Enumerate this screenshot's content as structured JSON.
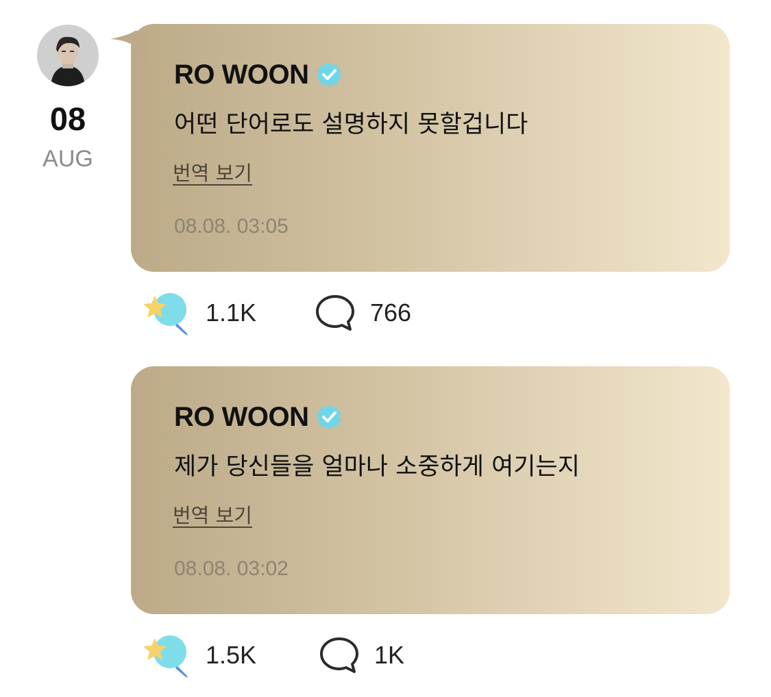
{
  "date": {
    "day": "08",
    "month": "AUG"
  },
  "avatar": {
    "icon": "user-avatar-photo"
  },
  "colors": {
    "bubble_gradient_start": "#bcaa88",
    "bubble_gradient_end": "#f2e6cc",
    "verified_badge": "#6fd6e8",
    "timestamp": "#8e8470"
  },
  "posts": [
    {
      "author": "RO WOON",
      "verified_icon": "verified-badge-icon",
      "message": "어떤 단어로도 설명하지 못할겁니다",
      "translate_label": "번역 보기",
      "timestamp": "08.08. 03:05",
      "likes": "1.1K",
      "comments": "766"
    },
    {
      "author": "RO WOON",
      "verified_icon": "verified-badge-icon",
      "message": "제가 당신들을 얼마나 소중하게 여기는지",
      "translate_label": "번역 보기",
      "timestamp": "08.08. 03:02",
      "likes": "1.5K",
      "comments": "1K"
    }
  ]
}
